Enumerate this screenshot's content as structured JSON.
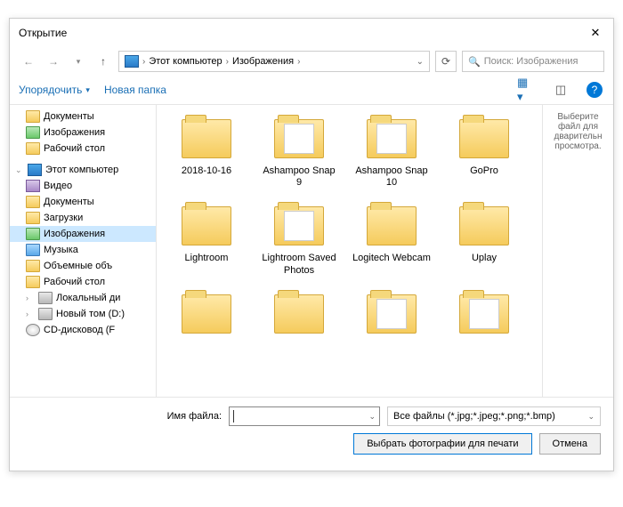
{
  "title": "Открытие",
  "breadcrumb": {
    "root": "Этот компьютер",
    "folder": "Изображения"
  },
  "search_placeholder": "Поиск: Изображения",
  "toolbar": {
    "organize": "Упорядочить",
    "new_folder": "Новая папка"
  },
  "tree": {
    "docs": "Документы",
    "pics": "Изображения",
    "desktop": "Рабочий стол",
    "this_pc": "Этот компьютер",
    "video": "Видео",
    "docs2": "Документы",
    "downloads": "Загрузки",
    "pics2": "Изображения",
    "music": "Музыка",
    "volumes": "Объемные объ",
    "desktop2": "Рабочий стол",
    "local_disk": "Локальный ди",
    "new_vol": "Новый том (D:)",
    "cd": "CD-дисковод (F"
  },
  "items": {
    "r1c1": "2018-10-16",
    "r1c2": "Ashampoo Snap 9",
    "r1c3": "Ashampoo Snap 10",
    "r1c4": "GoPro",
    "r2c1": "Lightroom",
    "r2c2": "Lightroom Saved Photos",
    "r2c3": "Logitech Webcam",
    "r2c4": "Uplay"
  },
  "preview_hint": "Выберите файл для дварительн просмотра.",
  "filename_label": "Имя файла:",
  "filename_value": "",
  "filter": "Все файлы (*.jpg;*.jpeg;*.png;*.bmp)",
  "open_btn": "Выбрать фотографии для печати",
  "cancel_btn": "Отмена"
}
